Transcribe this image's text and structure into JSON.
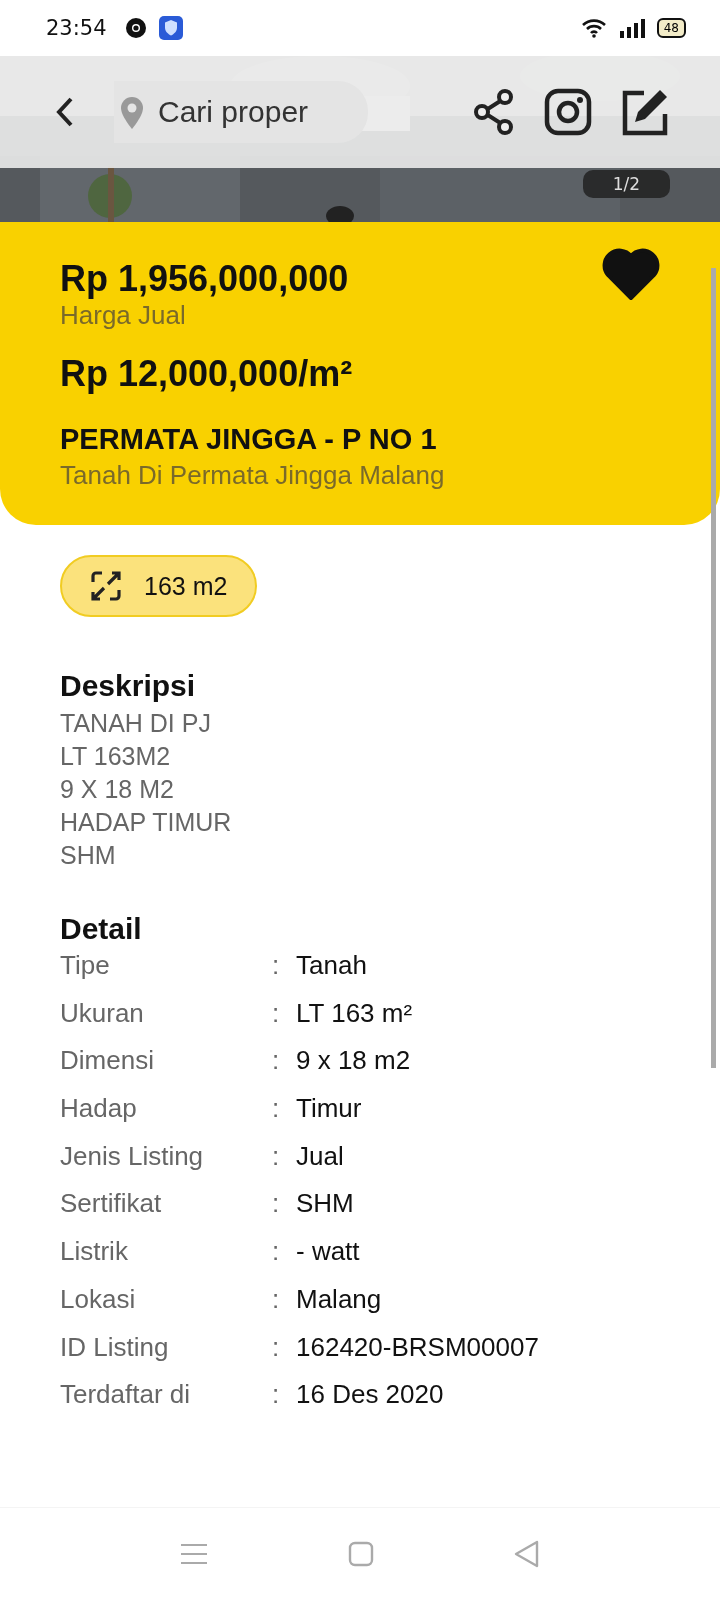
{
  "status_bar": {
    "time": "23:54",
    "battery": "48"
  },
  "header": {
    "search": {
      "placeholder": "Cari proper"
    }
  },
  "gallery": {
    "counter": "1/2"
  },
  "listing": {
    "price": "Rp 1,956,000,000",
    "price_label": "Harga Jual",
    "price_per_area": "Rp 12,000,000/m²",
    "title": "PERMATA JINGGA - P NO 1",
    "subtitle": "Tanah Di Permata Jingga Malang",
    "favorite": true
  },
  "area_chip": "163 m2",
  "description": {
    "heading": "Deskripsi",
    "lines": [
      "TANAH DI PJ",
      "LT 163M2",
      "9 X 18 M2",
      "HADAP TIMUR",
      "SHM"
    ]
  },
  "detail": {
    "heading": "Detail",
    "rows": [
      {
        "label": "Tipe",
        "separator": ":",
        "value": "Tanah"
      },
      {
        "label": "Ukuran",
        "separator": ":",
        "value": "LT 163 m²"
      },
      {
        "label": "Dimensi",
        "separator": ":",
        "value": "9 x 18 m2"
      },
      {
        "label": "Hadap",
        "separator": ":",
        "value": "Timur"
      },
      {
        "label": "Jenis Listing",
        "separator": ":",
        "value": "Jual"
      },
      {
        "label": "Sertifikat",
        "separator": ":",
        "value": "SHM"
      },
      {
        "label": "Listrik",
        "separator": ":",
        "value": "- watt"
      },
      {
        "label": "Lokasi",
        "separator": ":",
        "value": "Malang"
      },
      {
        "label": "ID Listing",
        "separator": ":",
        "value": "162420-BRSM00007"
      },
      {
        "label": "Terdaftar di",
        "separator": ":",
        "value": "16 Des 2020"
      }
    ]
  }
}
